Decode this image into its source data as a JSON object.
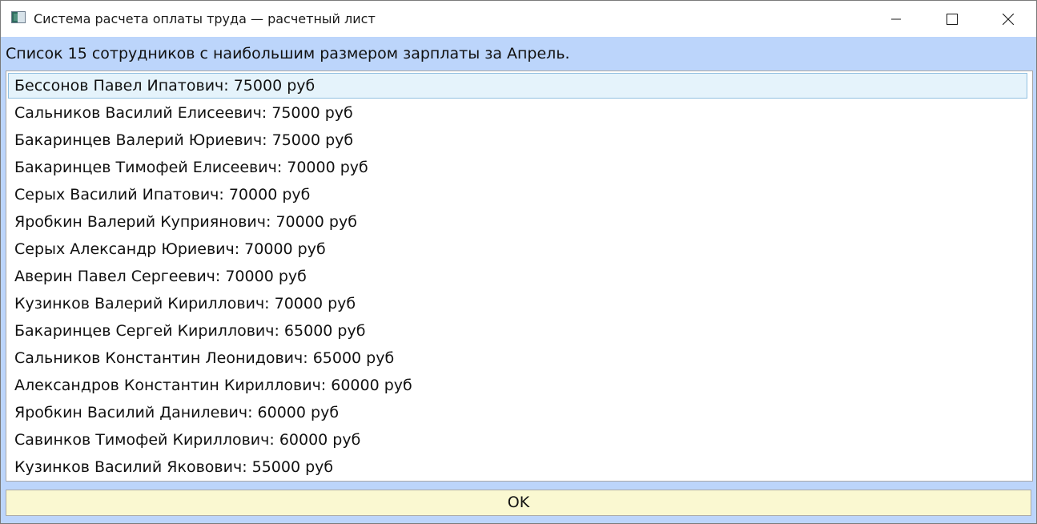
{
  "window": {
    "title": "Система расчета оплаты труда — расчетный лист",
    "icon": "app-window-icon",
    "controls": {
      "minimize_icon": "minimize-icon",
      "maximize_icon": "maximize-icon",
      "close_icon": "close-icon"
    }
  },
  "header": {
    "label": "Список 15 сотрудников с наибольшим размером зарплаты за Апрель."
  },
  "employees": {
    "selected_index": 0,
    "items": [
      "Бессонов Павел Ипатович: 75000 руб",
      "Сальников Василий Елисеевич: 75000 руб",
      "Бакаринцев Валерий Юриевич: 75000 руб",
      "Бакаринцев Тимофей Елисеевич: 70000 руб",
      "Серых Василий Ипатович: 70000 руб",
      "Яробкин Валерий Куприянович: 70000 руб",
      "Серых Александр Юриевич: 70000 руб",
      "Аверин Павел Сергеевич: 70000 руб",
      "Кузинков Валерий Кириллович: 70000 руб",
      "Бакаринцев Сергей Кириллович: 65000 руб",
      "Сальников Константин Леонидович: 65000 руб",
      "Александров Константин Кириллович: 60000 руб",
      "Яробкин Василий Данилевич: 60000 руб",
      "Савинков Тимофей Кириллович: 60000 руб",
      "Кузинков Василий Яковович: 55000 руб"
    ]
  },
  "footer": {
    "ok_label": "OK"
  },
  "colors": {
    "window_background": "#bcd5fb",
    "selected_row": "#e5f3fb",
    "selected_border": "#92c0e0",
    "ok_button": "#faf8d1"
  }
}
